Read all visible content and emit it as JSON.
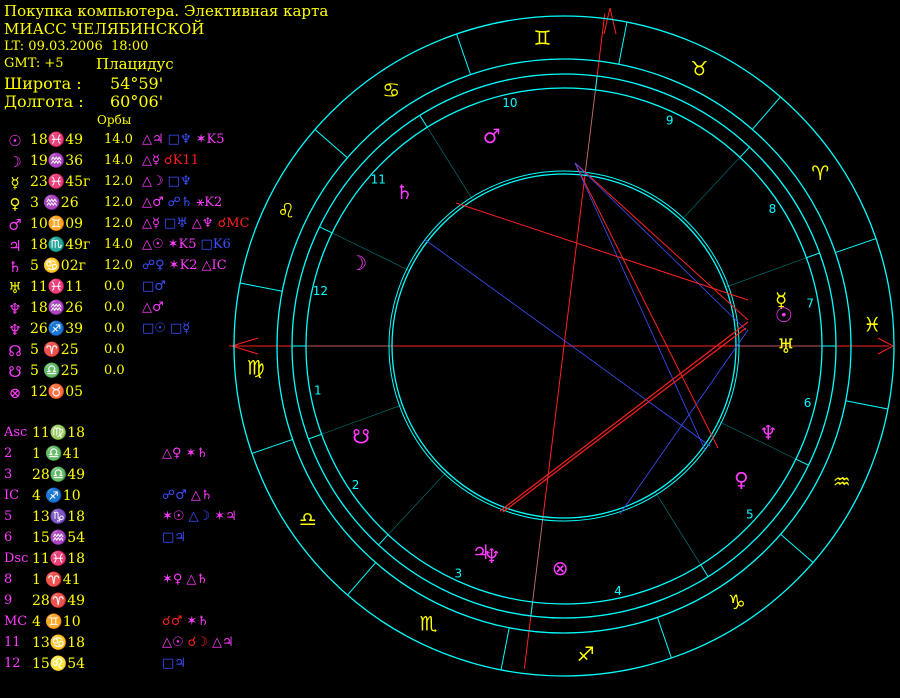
{
  "header": {
    "title": "Покупка компьютера. Элективная карта",
    "city": "МИАСС ЧЕЛЯБИНСКОЙ",
    "lt": "LT: 09.03.2006  18:00",
    "gmt": "GMT: +5",
    "house_system": "Плацидус",
    "lat_label": "Широта :",
    "lat_value": "54°59'",
    "lon_label": "Долгота :",
    "lon_value": "60°06'",
    "orbs_label": "Орбы"
  },
  "planets": [
    {
      "glyph": "☉",
      "color": "#ff3cff",
      "pos": "18♓49",
      "orb": "14.0",
      "aspects": [
        [
          "△♃",
          "#ff3cff"
        ],
        [
          "□♆",
          "#3c50ff"
        ],
        [
          "✶K5",
          "#ff3cff"
        ]
      ]
    },
    {
      "glyph": "☽",
      "color": "#ff3cff",
      "pos": "19♒36",
      "orb": "14.0",
      "aspects": [
        [
          "△☿",
          "#ff3cff"
        ],
        [
          "☌K11",
          "#ff2020"
        ]
      ]
    },
    {
      "glyph": "☿",
      "color": "#ffff00",
      "pos": "23♓45г",
      "orb": "12.0",
      "aspects": [
        [
          "△☽",
          "#ff3cff"
        ],
        [
          "□♆",
          "#3c50ff"
        ]
      ]
    },
    {
      "glyph": "♀",
      "color": "#ffff00",
      "pos": "3 ♒26",
      "orb": "12.0",
      "aspects": [
        [
          "△♂",
          "#ff3cff"
        ],
        [
          "☍♄",
          "#3c50ff"
        ],
        [
          "⚹K2",
          "#ff3cff"
        ]
      ]
    },
    {
      "glyph": "♂",
      "color": "#ff3cff",
      "pos": "10♊09",
      "orb": "12.0",
      "aspects": [
        [
          "△☿",
          "#ff3cff"
        ],
        [
          "□♅",
          "#3c50ff"
        ],
        [
          "△♆",
          "#ff3cff"
        ],
        [
          "☌MC",
          "#ff2020"
        ]
      ]
    },
    {
      "glyph": "♃",
      "color": "#ff3cff",
      "pos": "18♏49г",
      "orb": "14.0",
      "aspects": [
        [
          "△☉",
          "#ff3cff"
        ],
        [
          "✶K5",
          "#ff3cff"
        ],
        [
          "□K6",
          "#3c50ff"
        ]
      ]
    },
    {
      "glyph": "♄",
      "color": "#ff3cff",
      "pos": "5 ♋02г",
      "orb": "12.0",
      "aspects": [
        [
          "☍♀",
          "#3c50ff"
        ],
        [
          "✶K2",
          "#ff3cff"
        ],
        [
          "△IC",
          "#ff3cff"
        ]
      ]
    },
    {
      "glyph": "♅",
      "color": "#ffff00",
      "pos": "11♓11",
      "orb": "0.0",
      "aspects": [
        [
          "□♂",
          "#3c50ff"
        ]
      ]
    },
    {
      "glyph": "♆",
      "color": "#ff3cff",
      "pos": "18♒26",
      "orb": "0.0",
      "aspects": [
        [
          "△♂",
          "#ff3cff"
        ]
      ]
    },
    {
      "glyph": "♆",
      "color": "#ff3cff",
      "pos": "26♐39",
      "orb": "0.0",
      "aspects": [
        [
          "□☉",
          "#3c50ff"
        ],
        [
          "□☿",
          "#3c50ff"
        ]
      ]
    },
    {
      "glyph": "☊",
      "color": "#ff3cff",
      "pos": "5 ♈25",
      "orb": "0.0",
      "aspects": []
    },
    {
      "glyph": "☋",
      "color": "#ff3cff",
      "pos": "5 ♎25",
      "orb": "0.0",
      "aspects": []
    },
    {
      "glyph": "⊗",
      "color": "#ff3cff",
      "pos": "12♉05",
      "orb": "",
      "aspects": []
    }
  ],
  "houses": [
    {
      "label": "Asc",
      "pos": "11♍18",
      "aspects": []
    },
    {
      "label": "2",
      "pos": "1 ♎41",
      "aspects": [
        [
          "△♀",
          "#ff3cff"
        ],
        [
          "✶♄",
          "#ff3cff"
        ]
      ]
    },
    {
      "label": "3",
      "pos": "28♎49",
      "aspects": []
    },
    {
      "label": "IC",
      "pos": "4 ♐10",
      "aspects": [
        [
          "☍♂",
          "#3c50ff"
        ],
        [
          "△♄",
          "#ff3cff"
        ]
      ]
    },
    {
      "label": "5",
      "pos": "13♑18",
      "aspects": [
        [
          "✶☉",
          "#ff3cff"
        ],
        [
          "△☽",
          "#3c50ff"
        ],
        [
          "✶♃",
          "#ff3cff"
        ]
      ]
    },
    {
      "label": "6",
      "pos": "15♒54",
      "aspects": [
        [
          "□♃",
          "#3c50ff"
        ]
      ]
    },
    {
      "label": "Dsc",
      "pos": "11♓18",
      "aspects": []
    },
    {
      "label": "8",
      "pos": "1 ♈41",
      "aspects": [
        [
          "✶♀",
          "#ff3cff"
        ],
        [
          "△♄",
          "#ff3cff"
        ]
      ]
    },
    {
      "label": "9",
      "pos": "28♈49",
      "aspects": []
    },
    {
      "label": "MC",
      "pos": "4 ♊10",
      "aspects": [
        [
          "☌♂",
          "#ff2020"
        ],
        [
          "✶♄",
          "#ff3cff"
        ]
      ]
    },
    {
      "label": "11",
      "pos": "13♋18",
      "aspects": [
        [
          "△☉",
          "#ff3cff"
        ],
        [
          "☌☽",
          "#ff2020"
        ],
        [
          "△♃",
          "#ff3cff"
        ]
      ]
    },
    {
      "label": "12",
      "pos": "15♌54",
      "aspects": [
        [
          "□♃",
          "#3c50ff"
        ]
      ]
    }
  ],
  "wheel": {
    "zodiac_glyphs": [
      {
        "g": "♈",
        "color": "#ffff00"
      },
      {
        "g": "♉",
        "color": "#ffff00"
      },
      {
        "g": "♊",
        "color": "#ffff00"
      },
      {
        "g": "♋",
        "color": "#ffff00"
      },
      {
        "g": "♌",
        "color": "#ffff00"
      },
      {
        "g": "♍",
        "color": "#ffff00"
      },
      {
        "g": "♎",
        "color": "#ffff00"
      },
      {
        "g": "♏",
        "color": "#ffff00"
      },
      {
        "g": "♐",
        "color": "#ffff00"
      },
      {
        "g": "♑",
        "color": "#ffff00"
      },
      {
        "g": "♒",
        "color": "#ffff00"
      },
      {
        "g": "♓",
        "color": "#ffff00"
      }
    ],
    "house_numbers": [
      "1",
      "2",
      "3",
      "4",
      "5",
      "6",
      "7",
      "8",
      "9",
      "10",
      "11",
      "12"
    ],
    "planet_glyphs": [
      {
        "g": "☽",
        "color": "#ff3cff"
      },
      {
        "g": "♄",
        "color": "#ff3cff"
      },
      {
        "g": "♂",
        "color": "#ff3cff"
      },
      {
        "g": "☿",
        "color": "#ffff00"
      },
      {
        "g": "☉",
        "color": "#ff3cff"
      },
      {
        "g": "♅",
        "color": "#ffff00"
      },
      {
        "g": "♆",
        "color": "#ff3cff"
      },
      {
        "g": "♀",
        "color": "#ff3cff"
      },
      {
        "g": "⊗",
        "color": "#ff3cff"
      },
      {
        "g": "♆",
        "color": "#ff3cff"
      },
      {
        "g": "♃",
        "color": "#ff3cff"
      },
      {
        "g": "☋",
        "color": "#ff3cff"
      }
    ],
    "colors": {
      "ring": "#00ffff",
      "axis": "#ff2020",
      "aspect_red": "#ff2020",
      "aspect_blue": "#3c50ff"
    }
  }
}
